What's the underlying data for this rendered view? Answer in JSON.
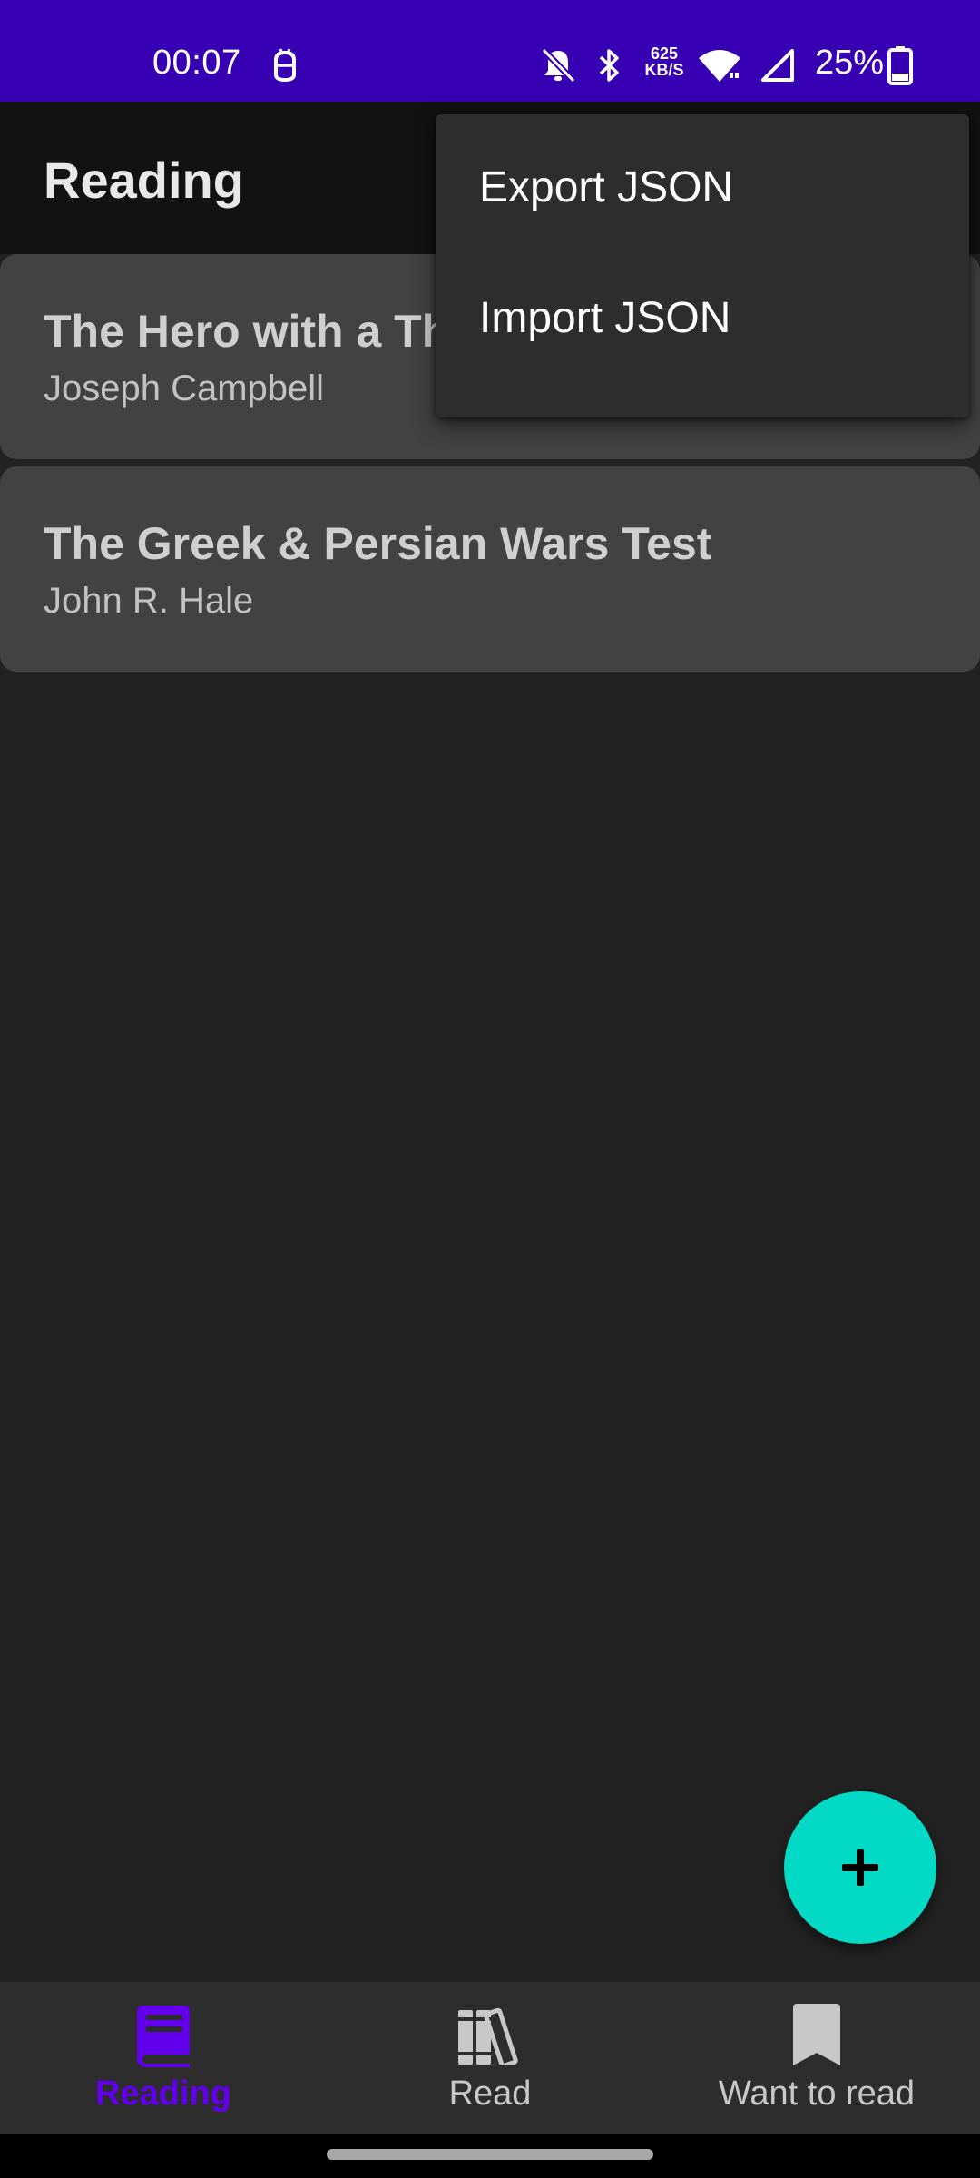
{
  "status_bar": {
    "time": "00:07",
    "network_speed_value": "625",
    "network_speed_unit": "KB/S",
    "battery_percent": "25%",
    "icons": [
      "debug-bug-icon",
      "bell-off-icon",
      "bluetooth-icon",
      "wifi-icon",
      "cell-signal-icon",
      "battery-icon"
    ]
  },
  "app_bar": {
    "title": "Reading"
  },
  "books": [
    {
      "title": "The Hero with a Thousand Faces",
      "author": "Joseph Campbell"
    },
    {
      "title": "The Greek & Persian Wars Test",
      "author": "John R. Hale"
    }
  ],
  "overflow_menu": {
    "items": [
      {
        "label": "Export JSON"
      },
      {
        "label": "Import JSON"
      }
    ]
  },
  "fab": {
    "icon": "plus-icon",
    "color": "#03dac5"
  },
  "bottom_nav": {
    "items": [
      {
        "label": "Reading",
        "icon": "book-icon",
        "active": true
      },
      {
        "label": "Read",
        "icon": "bookshelf-icon",
        "active": false
      },
      {
        "label": "Want to read",
        "icon": "bookmark-icon",
        "active": false
      }
    ]
  },
  "colors": {
    "status_bar": "#3700b3",
    "app_bar": "#121212",
    "background": "#222222",
    "card": "#424242",
    "menu": "#2d2d2d",
    "accent_active": "#6200ee",
    "fab": "#03dac5"
  }
}
